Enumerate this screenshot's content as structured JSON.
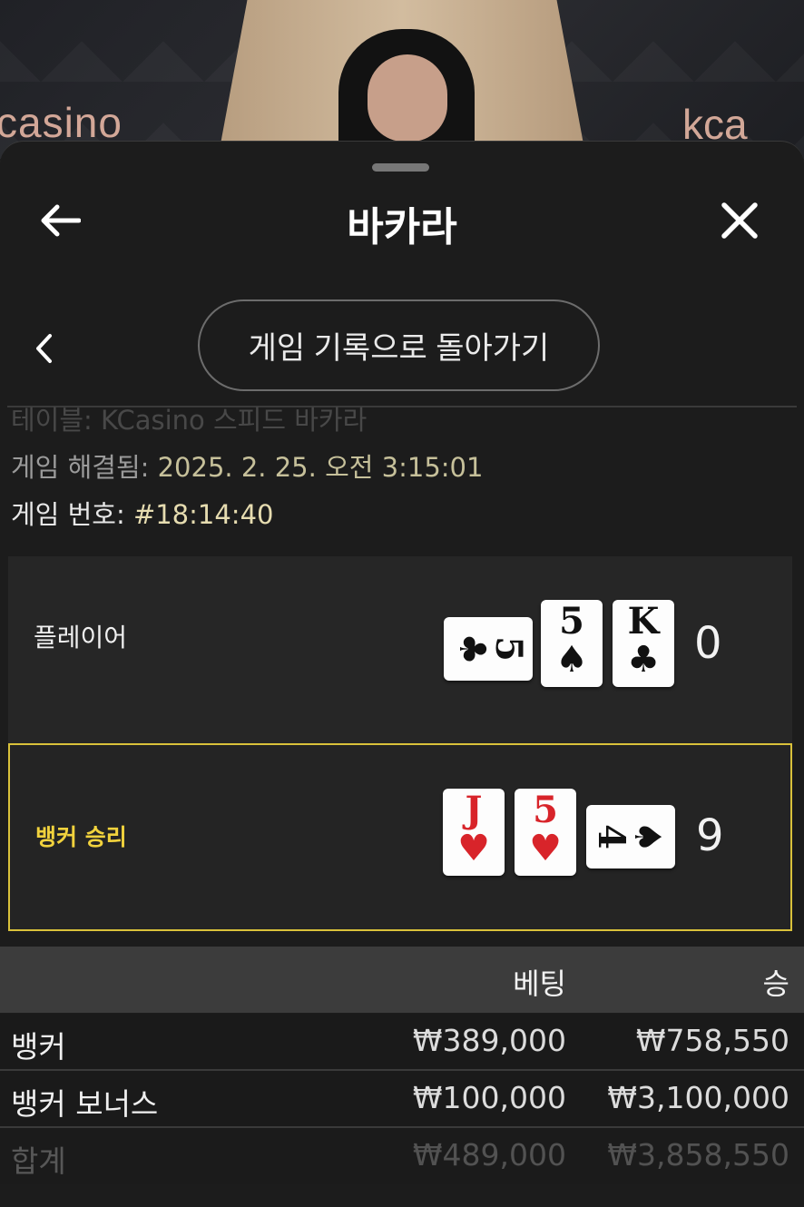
{
  "video": {
    "logo_left": "casino",
    "logo_right": "kca"
  },
  "header": {
    "title": "바카라"
  },
  "navigation": {
    "back_to_history_label": "게임 기록으로 돌아가기"
  },
  "info": {
    "table_label": "테이블:",
    "table_value": "KCasino 스피드 바카라",
    "resolved_label": "게임 해결됨:",
    "resolved_value": "2025. 2. 25. 오전 3:15:01",
    "number_label": "게임 번호:",
    "number_value": "#18:14:40"
  },
  "hands": {
    "player": {
      "label": "플레이어",
      "score": "0",
      "cards": [
        {
          "rank": "5",
          "suit": "♣",
          "color": "#111111",
          "orientation": "horizontal"
        },
        {
          "rank": "5",
          "suit": "♠",
          "color": "#111111",
          "orientation": "vertical"
        },
        {
          "rank": "K",
          "suit": "♣",
          "color": "#111111",
          "orientation": "vertical"
        }
      ]
    },
    "banker": {
      "label": "뱅커 승리",
      "score": "9",
      "highlight_color": "#d9c13a",
      "cards": [
        {
          "rank": "J",
          "suit": "♥",
          "color": "#d8242a",
          "orientation": "vertical"
        },
        {
          "rank": "5",
          "suit": "♥",
          "color": "#d8242a",
          "orientation": "vertical"
        },
        {
          "rank": "4",
          "suit": "♠",
          "color": "#111111",
          "orientation": "horizontal"
        }
      ]
    }
  },
  "bets": {
    "headers": {
      "bet": "베팅",
      "win": "승"
    },
    "rows": [
      {
        "name": "뱅커",
        "bet": "₩389,000",
        "win": "₩758,550"
      },
      {
        "name": "뱅커 보너스",
        "bet": "₩100,000",
        "win": "₩3,100,000"
      },
      {
        "name": "합계",
        "bet": "₩489,000",
        "win": "₩3,858,550"
      }
    ]
  }
}
